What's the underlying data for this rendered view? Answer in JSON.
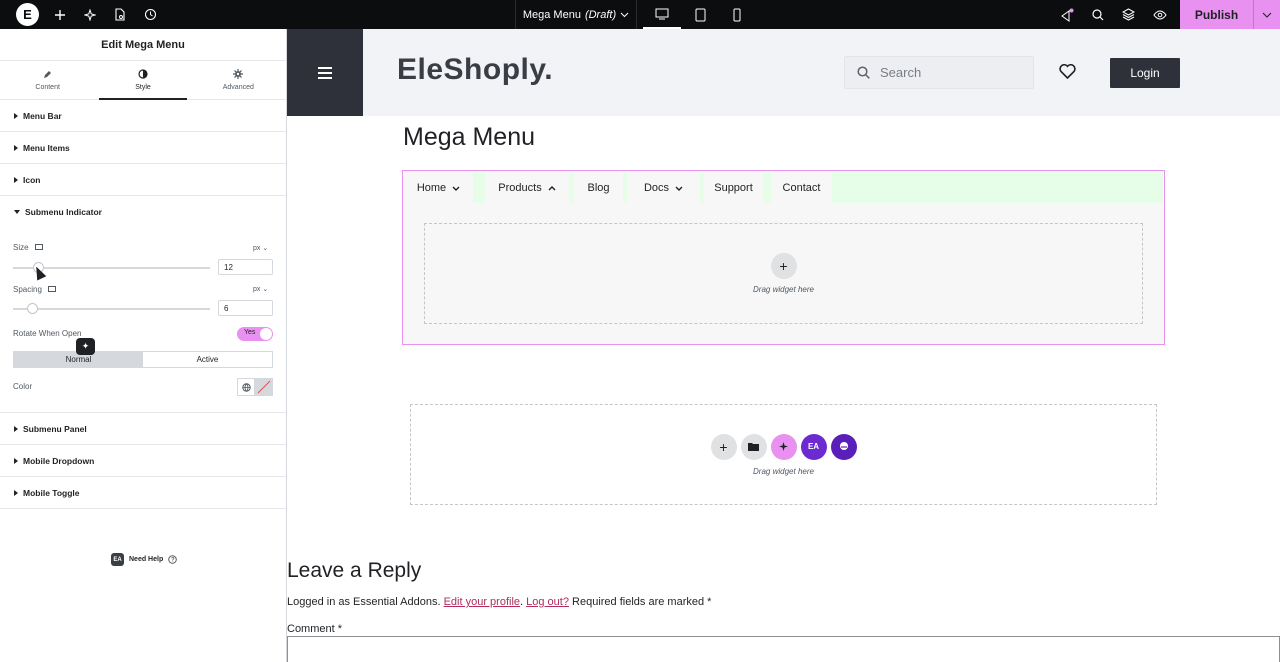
{
  "topbar": {
    "logo": "E",
    "title_prefix": "Mega Menu",
    "title_status": "(Draft)",
    "publish_label": "Publish",
    "devices": [
      "desktop",
      "tablet",
      "mobile"
    ]
  },
  "panel": {
    "title": "Edit Mega Menu",
    "tabs": [
      {
        "label": "Content",
        "icon": "pencil-icon"
      },
      {
        "label": "Style",
        "icon": "contrast-icon"
      },
      {
        "label": "Advanced",
        "icon": "gear-icon"
      }
    ],
    "sections_top": [
      "Menu Bar",
      "Menu Items",
      "Icon"
    ],
    "open_section": "Submenu Indicator",
    "size": {
      "label": "Size",
      "unit": "px",
      "value": "12"
    },
    "spacing": {
      "label": "Spacing",
      "unit": "px",
      "value": "6"
    },
    "rotate_label": "Rotate When Open",
    "rotate_toggle": "Yes",
    "states": [
      "Normal",
      "Active"
    ],
    "color_label": "Color",
    "sections_bottom": [
      "Submenu Panel",
      "Mobile Dropdown",
      "Mobile Toggle"
    ],
    "need_help": "Need Help"
  },
  "site": {
    "brand": "EleShoply.",
    "search_placeholder": "Search",
    "login_label": "Login",
    "mega_title": "Mega Menu",
    "menu": [
      {
        "label": "Home",
        "arrow": "⌄"
      },
      {
        "label": "Products",
        "arrow": "⌃"
      },
      {
        "label": "Blog",
        "arrow": ""
      },
      {
        "label": "Docs",
        "arrow": "⌄"
      },
      {
        "label": "Support",
        "arrow": ""
      },
      {
        "label": "Contact",
        "arrow": ""
      }
    ],
    "drag_text": "Drag widget here",
    "reply_title": "Leave a Reply",
    "logged_in_prefix": "Logged in as Essential Addons.",
    "edit_profile": "Edit your profile",
    "logout": "Log out?",
    "required_text": "Required fields are marked *",
    "comment_label": "Comment *"
  },
  "colors": {
    "accent": "#e991f0",
    "dark": "#2e3139",
    "menubar": "#e6fde8"
  }
}
